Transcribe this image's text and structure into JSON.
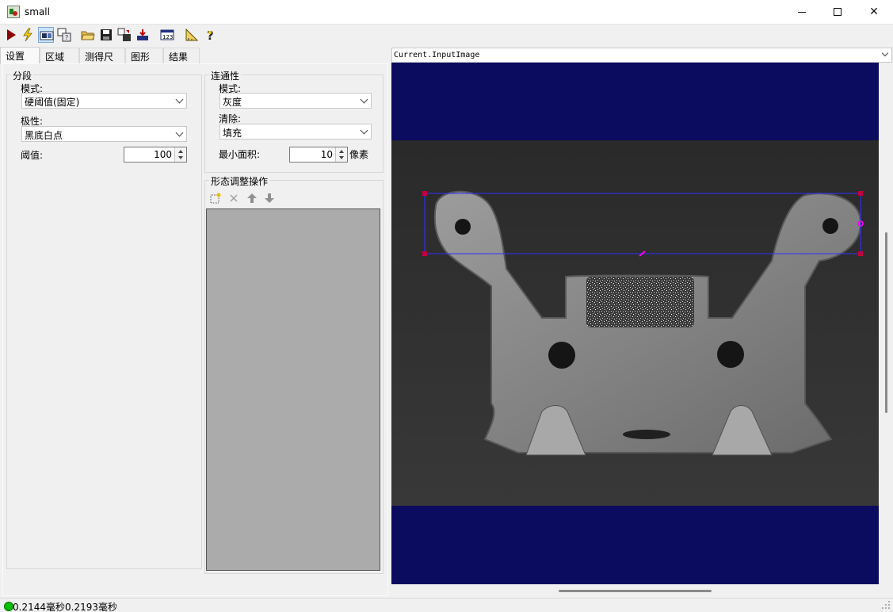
{
  "window": {
    "title": "small"
  },
  "toolbar": {
    "items": [
      {
        "icon": "run-icon"
      },
      {
        "icon": "lightning-icon"
      },
      {
        "icon": "image-display-icon"
      },
      {
        "icon": "edit-image-icon"
      },
      {
        "icon": "open-folder-icon"
      },
      {
        "icon": "save-icon"
      },
      {
        "icon": "graphics-icon"
      },
      {
        "icon": "import-icon"
      },
      {
        "icon": "numeric-display-icon"
      },
      {
        "icon": "ruler-icon"
      },
      {
        "icon": "help-icon"
      }
    ]
  },
  "tabs": [
    {
      "label": "设置"
    },
    {
      "label": "区域"
    },
    {
      "label": "测得尺寸"
    },
    {
      "label": "图形"
    },
    {
      "label": "结果"
    }
  ],
  "segmentation": {
    "title": "分段",
    "mode_label": "模式:",
    "mode_value": "硬阈值(固定)",
    "polarity_label": "极性:",
    "polarity_value": "黑底白点",
    "threshold_label": "阈值:",
    "threshold_value": "100"
  },
  "connectivity": {
    "title": "连通性",
    "mode_label": "模式:",
    "mode_value": "灰度",
    "clear_label": "清除:",
    "clear_value": "填充",
    "min_area_label": "最小面积:",
    "min_area_value": "10",
    "min_area_unit": "像素"
  },
  "morphology": {
    "title": "形态调整操作"
  },
  "image_selector": {
    "value": "Current.InputImage"
  },
  "status": {
    "text": "0.2144毫秒0.2193毫秒",
    "color": "#00c000"
  },
  "colors": {
    "viewer_background": "#0b0b60",
    "region_box": "#3030ff",
    "handle": "#c00040"
  }
}
